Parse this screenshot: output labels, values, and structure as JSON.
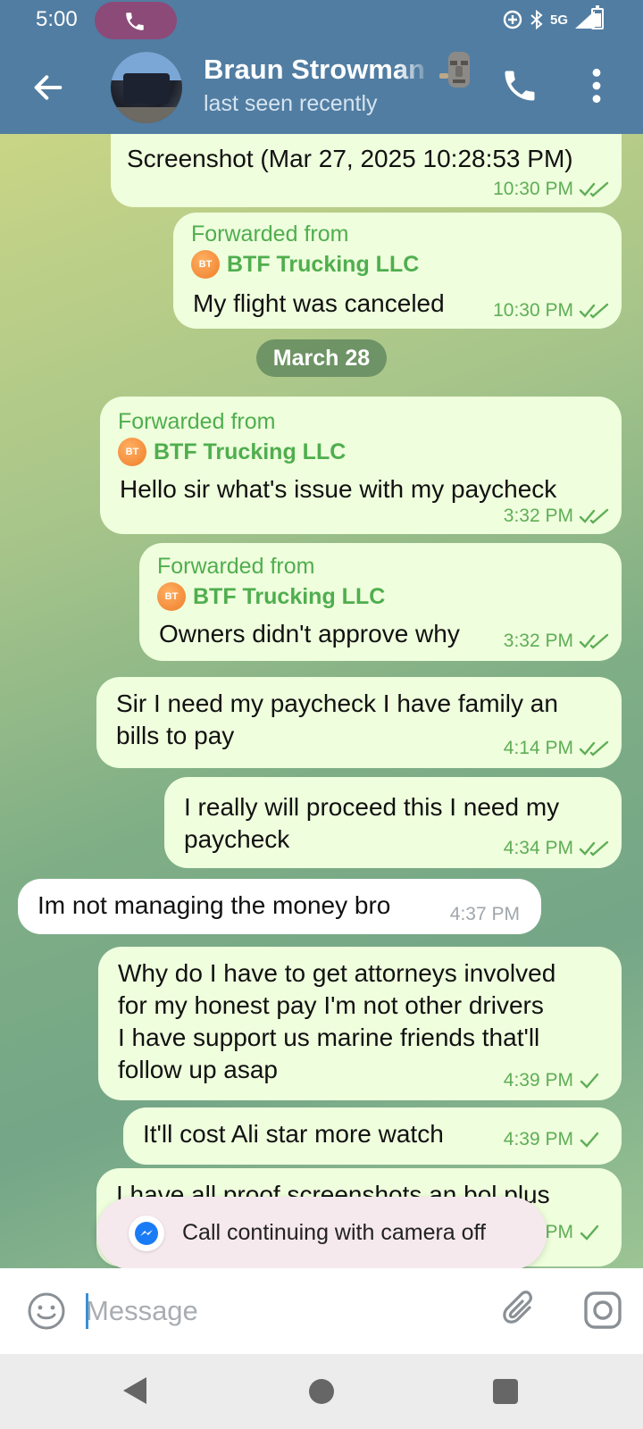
{
  "status_bar": {
    "time": "5:00",
    "network": "5G",
    "icons": [
      "phone-call-icon",
      "data-saver-icon",
      "bluetooth-icon",
      "signal-icon",
      "battery-icon"
    ]
  },
  "header": {
    "contact_name": "Braun Strowman",
    "status": "last seen recently",
    "icons": [
      "back-arrow-icon",
      "moai-emoji",
      "phone-icon",
      "more-vertical-icon"
    ]
  },
  "chat": {
    "date_separator": "March 28",
    "forward_label": "Forwarded from",
    "forward_source": "BTF Trucking LLC",
    "forward_badge": "BT",
    "messages": [
      {
        "direction": "out",
        "lines": [
          "Screenshot (Mar 27, 2025 10:28:53 PM)"
        ],
        "time": "10:30 PM",
        "status": "read"
      },
      {
        "direction": "out",
        "forwarded": true,
        "lines": [
          "My flight was canceled"
        ],
        "time": "10:30 PM",
        "status": "read"
      },
      {
        "direction": "out",
        "forwarded": true,
        "lines": [
          "Hello sir what's issue with my paycheck"
        ],
        "time": "3:32 PM",
        "status": "read"
      },
      {
        "direction": "out",
        "forwarded": true,
        "lines": [
          "Owners didn't approve why"
        ],
        "time": "3:32 PM",
        "status": "read"
      },
      {
        "direction": "out",
        "lines": [
          "Sir I need my paycheck I have family an",
          "bills to pay"
        ],
        "time": "4:14 PM",
        "status": "read"
      },
      {
        "direction": "out",
        "lines": [
          "I really will proceed this I need my",
          "paycheck"
        ],
        "time": "4:34 PM",
        "status": "read"
      },
      {
        "direction": "in",
        "lines": [
          "Im not managing the money bro"
        ],
        "time": "4:37 PM"
      },
      {
        "direction": "out",
        "lines": [
          "Why do I have to get attorneys involved",
          "for my honest pay I'm not other drivers",
          "I have support us marine friends that'll",
          "follow up asap"
        ],
        "time": "4:39 PM",
        "status": "sent"
      },
      {
        "direction": "out",
        "lines": [
          "It'll cost Ali star more watch"
        ],
        "time": "4:39 PM",
        "status": "sent"
      },
      {
        "direction": "out",
        "lines": [
          "I have all proof screenshots an bol plus"
        ],
        "time": "PM",
        "status": "sent"
      }
    ]
  },
  "toast": {
    "text": "Call continuing with camera off",
    "icon": "messenger-icon"
  },
  "composer": {
    "placeholder": "Message",
    "icons": [
      "emoji-icon",
      "attach-icon",
      "camera-icon"
    ]
  },
  "nav_bar": {
    "icons": [
      "nav-back-icon",
      "nav-home-icon",
      "nav-recents-icon"
    ]
  },
  "colors": {
    "header": "#517da2",
    "bubble_out": "#effedd",
    "bubble_in": "#ffffff",
    "accent_green": "#4fae4e",
    "toast_bg": "#f6e9ee"
  }
}
